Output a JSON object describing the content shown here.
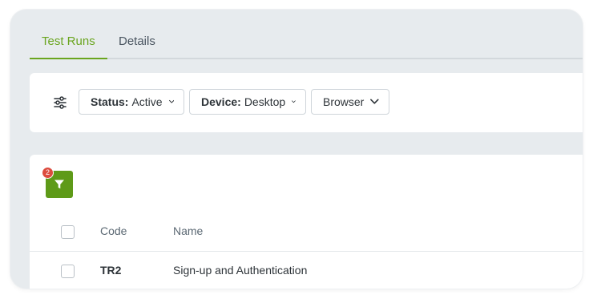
{
  "tabs": [
    {
      "label": "Test Runs",
      "active": true
    },
    {
      "label": "Details",
      "active": false
    }
  ],
  "filters": {
    "settings_icon": "sliders-icon",
    "chips": [
      {
        "key": "Status:",
        "value": "Active"
      },
      {
        "key": "Device:",
        "value": "Desktop"
      },
      {
        "key": "",
        "value": "Browser"
      }
    ]
  },
  "table": {
    "filter_button_icon": "funnel-icon",
    "filter_badge_count": "2",
    "columns": [
      "Code",
      "Name"
    ],
    "rows": [
      {
        "code": "TR2",
        "name": "Sign-up and Authentication"
      }
    ]
  },
  "colors": {
    "accent": "#6aa51f",
    "filter_button": "#5e9a18",
    "badge": "#dc4b3e",
    "background": "#e7ebee"
  }
}
